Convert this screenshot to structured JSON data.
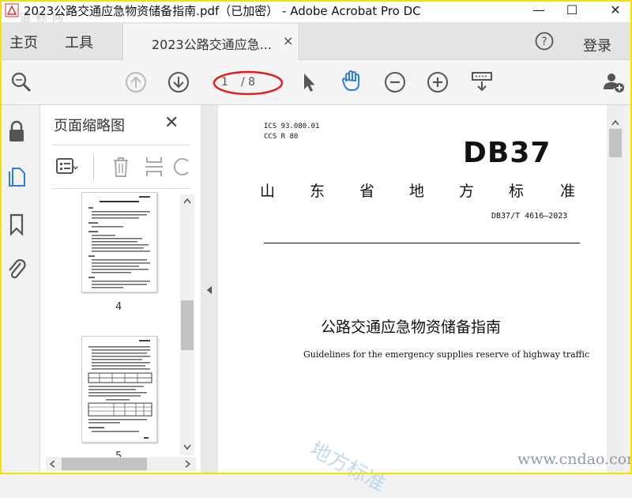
{
  "window": {
    "title": "2023公路交通应急物资储备指南.pdf（已加密） - Adobe Acrobat Pro DC",
    "watermark_top": "道 标 网",
    "minimize_glyph": "—",
    "maximize_glyph": "☐",
    "close_glyph": "✕"
  },
  "menubar": {
    "home": "主页",
    "tools": "工具",
    "tab_label": "2023公路交通应急...",
    "tab_close": "×",
    "login": "登录"
  },
  "toolbar": {
    "page_current": "1",
    "page_total": "/ 8",
    "icons": [
      "zoom-search-icon",
      "prev-page-icon",
      "next-page-icon",
      "select-cursor-icon",
      "hand-tool-icon",
      "zoom-out-icon",
      "zoom-in-icon",
      "fit-page-icon",
      "share-user-icon"
    ],
    "hand_color": "#2d7de0"
  },
  "sidebar": {
    "panel_title": "页面缩略图",
    "panel_close": "✕",
    "thumbnails": [
      {
        "number": "4"
      },
      {
        "number": "5"
      }
    ]
  },
  "document": {
    "ics": "ICS  93.080.01",
    "ccs": "CCS  R 80",
    "db_label": "DB37",
    "province": [
      "山",
      "东",
      "省",
      "地",
      "方",
      "标",
      "准"
    ],
    "std_number": "DB37/T 4616—2023",
    "title_cn": "公路交通应急物资储备指南",
    "title_en": "Guidelines for the emergency supplies reserve of highway traffic",
    "watermark_diag": "地方标准",
    "watermark_site": "www.cndao.com"
  },
  "colors": {
    "frame": "#f4e300",
    "annotation": "#e02020",
    "accent": "#2d7de0"
  }
}
